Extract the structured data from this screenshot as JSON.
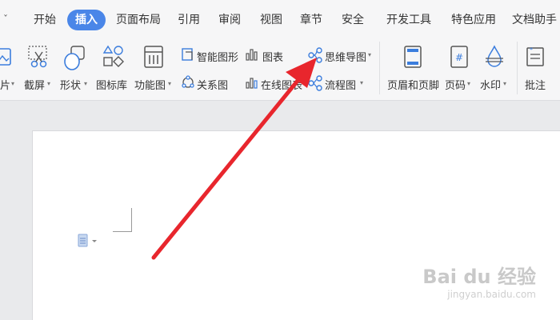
{
  "tabs": [
    "开始",
    "插入",
    "页面布局",
    "引用",
    "审阅",
    "视图",
    "章节",
    "安全",
    "开发工具",
    "特色应用",
    "文档助手"
  ],
  "active_tab": "插入",
  "ribbon": {
    "picture": "片",
    "screenshot": "截屏",
    "shape": "形状",
    "icon_library": "图标库",
    "function_chart": "功能图",
    "smart_graphic": "智能图形",
    "chart": "图表",
    "relation_chart": "关系图",
    "online_chart": "在线图表",
    "mind_map": "思维导图",
    "flowchart": "流程图",
    "header_footer": "页眉和页脚",
    "page_number": "页码",
    "watermark": "水印",
    "comment": "批注"
  },
  "watermark": {
    "main": "Bai du 经验",
    "sub": "jingyan.baidu.com"
  },
  "colors": {
    "active_tab": "#4a86e8",
    "arrow": "#e8262d",
    "icon_blue": "#3b7ddd"
  }
}
